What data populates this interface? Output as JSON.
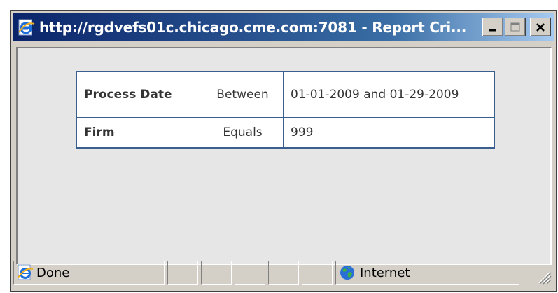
{
  "window": {
    "title": "http://rgdvefs01c.chicago.cme.com:7081 - Report Cri...",
    "title_icon": "ie-page-icon",
    "buttons": [
      "minimize",
      "maximize",
      "close"
    ]
  },
  "criteria": {
    "rows": [
      {
        "name": "Process Date",
        "operator": "Between",
        "value": "01-01-2009 and 01-29-2009"
      },
      {
        "name": "Firm",
        "operator": "Equals",
        "value": "999"
      }
    ]
  },
  "statusbar": {
    "status_text": "Done",
    "status_icon": "ie-page-icon",
    "zone_text": "Internet",
    "zone_icon": "globe-icon"
  },
  "colors": {
    "titlebar_start": "#0a246a",
    "titlebar_end": "#a6caf0",
    "table_border": "#3a5f8f"
  }
}
